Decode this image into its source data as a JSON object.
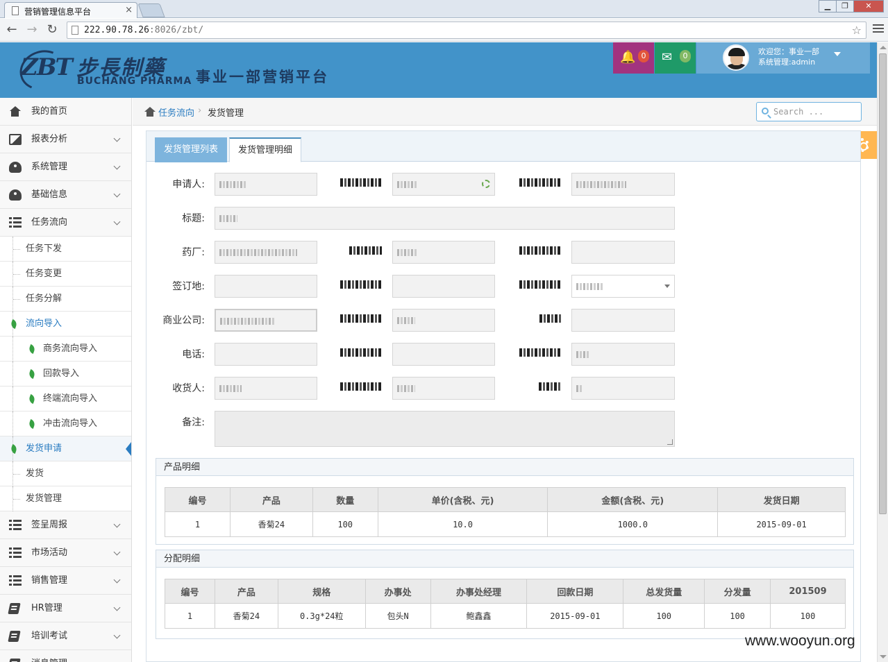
{
  "browser": {
    "tab_title": "营销管理信息平台",
    "tab_close": "×",
    "url_host": "222.90.78.26",
    "url_rest": ":8026/zbt/",
    "back_glyph": "←",
    "forward_glyph": "→",
    "reload_glyph": "↻",
    "star_glyph": "☆",
    "window_controls": [
      "▁",
      "❐",
      "✕"
    ]
  },
  "header": {
    "logo_mark": "ZBT",
    "logo_cn": "步長制藥",
    "logo_en": "BUCHANG PHARMA",
    "platform_title": "事业一部营销平台",
    "notifications": {
      "count": "0",
      "icon": "bell-icon",
      "glyph": "🔔"
    },
    "messages": {
      "count": "0",
      "icon": "envelope-icon",
      "glyph": "✉"
    },
    "user": {
      "welcome": "欢迎您：事业一部",
      "role": "系统管理:admin"
    }
  },
  "sidebar": {
    "items": [
      {
        "label": "我的首页",
        "icon": "home-icon"
      },
      {
        "label": "报表分析",
        "icon": "picture-icon"
      },
      {
        "label": "系统管理",
        "icon": "dashboard-icon"
      },
      {
        "label": "基础信息",
        "icon": "dashboard-icon"
      },
      {
        "label": "任务流向",
        "icon": "list-icon"
      }
    ],
    "task_children": [
      "任务下发",
      "任务变更",
      "任务分解"
    ],
    "flow_import": "流向导入",
    "flow_children": [
      "商务流向导入",
      "回款导入",
      "终端流向导入",
      "冲击流向导入"
    ],
    "ship_request": "发货申请",
    "ship_children": [
      "发货",
      "发货管理"
    ],
    "bottom_items": [
      {
        "label": "签呈周报",
        "icon": "list-icon"
      },
      {
        "label": "市场活动",
        "icon": "list-icon"
      },
      {
        "label": "销售管理",
        "icon": "list-icon"
      },
      {
        "label": "HR管理",
        "icon": "book-icon"
      },
      {
        "label": "培训考试",
        "icon": "book-icon"
      },
      {
        "label": "消息管理",
        "icon": "book-icon"
      }
    ]
  },
  "breadcrumb": {
    "parent": "任务流向",
    "sep": "›",
    "current": "发货管理"
  },
  "search": {
    "placeholder": "Search ..."
  },
  "tabs": [
    "发货管理列表",
    "发货管理明细"
  ],
  "form": {
    "labels": {
      "applicant": "申请人:",
      "title": "标题:",
      "factory": "药厂:",
      "sign_place": "签订地:",
      "company": "商业公司:",
      "phone": "电话:",
      "receiver": "收货人:",
      "note": "备注:"
    }
  },
  "products": {
    "heading": "产品明细",
    "columns": [
      "编号",
      "产品",
      "数量",
      "单价(含税、元)",
      "金额(含税、元)",
      "发货日期"
    ],
    "rows": [
      [
        "1",
        "香菊24",
        "100",
        "10.0",
        "1000.0",
        "2015-09-01"
      ]
    ]
  },
  "allocation": {
    "heading": "分配明细",
    "columns": [
      "编号",
      "产品",
      "规格",
      "办事处",
      "办事处经理",
      "回款日期",
      "总发货量",
      "分发量",
      "201509"
    ],
    "rows": [
      [
        "1",
        "香菊24",
        "0.3g*24粒",
        "包头N",
        "鲍鑫鑫",
        "2015-09-01",
        "100",
        "100",
        "100"
      ]
    ]
  },
  "watermark": "www.wooyun.org"
}
